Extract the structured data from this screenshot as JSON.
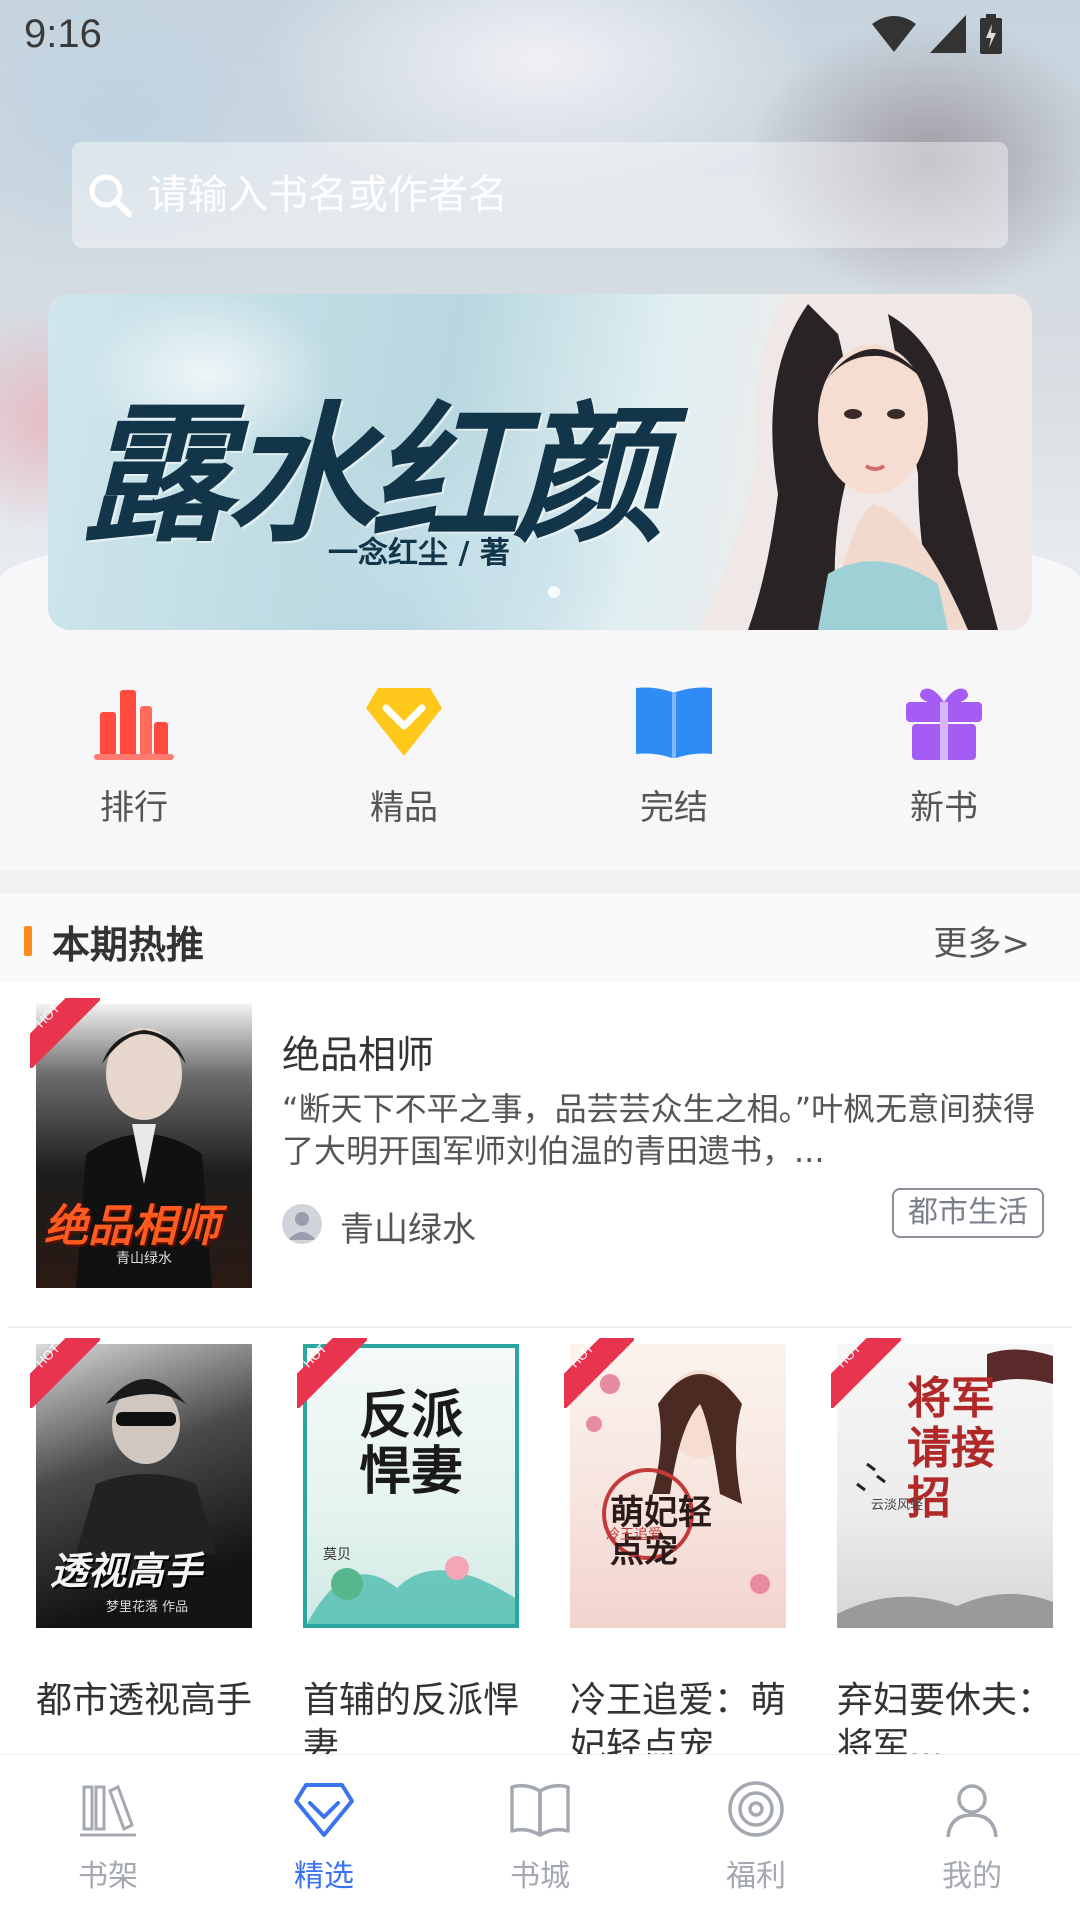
{
  "status_bar": {
    "time": "9:16"
  },
  "search": {
    "placeholder": "请输入书名或作者名"
  },
  "banner": {
    "title": "露水红颜",
    "author": "一念红尘 / 著",
    "dot_count": 1
  },
  "quick_nav": [
    {
      "label": "排行",
      "icon": "bar-chart-icon",
      "color": "#ff4a3d"
    },
    {
      "label": "精品",
      "icon": "diamond-icon",
      "color": "#ffc81a"
    },
    {
      "label": "完结",
      "icon": "open-book-icon",
      "color": "#2f8cf5"
    },
    {
      "label": "新书",
      "icon": "gift-icon",
      "color": "#a45cf5"
    }
  ],
  "hot_section": {
    "title": "本期热推",
    "more": "更多>",
    "accent_color": "#ff8a1f",
    "featured": {
      "badge": "HOT",
      "title": "绝品相师",
      "description": "“断天下不平之事，品芸芸众生之相。”叶枫无意间获得了大明开国军师刘伯温的青田遗书，...",
      "author": "青山绿水",
      "category": "都市生活",
      "cover_text": "绝品相师",
      "cover_author": "青山绿水"
    },
    "books": [
      {
        "badge": "HOT",
        "title": "都市透视高手",
        "cover_text": "透视高手",
        "cover_sub": "梦里花落 作品"
      },
      {
        "badge": "HOT",
        "title": "首辅的反派悍妻",
        "cover_text": "反派悍妻",
        "cover_sub": "莫贝"
      },
      {
        "badge": "HOT",
        "title": "冷王追爱：萌妃轻点宠",
        "cover_text": "萌妃轻点宠",
        "cover_sub": "冷王追爱"
      },
      {
        "badge": "HOT",
        "title": "弃妇要休夫：将军...",
        "cover_text": "将军请接招",
        "cover_sub": "云淡风轻"
      }
    ]
  },
  "tab_bar": [
    {
      "label": "书架",
      "icon": "bookshelf-icon",
      "active": false
    },
    {
      "label": "精选",
      "icon": "diamond-outline-icon",
      "active": true
    },
    {
      "label": "书城",
      "icon": "book-icon",
      "active": false
    },
    {
      "label": "福利",
      "icon": "welfare-circle-icon",
      "active": false
    },
    {
      "label": "我的",
      "icon": "user-icon",
      "active": false
    }
  ]
}
